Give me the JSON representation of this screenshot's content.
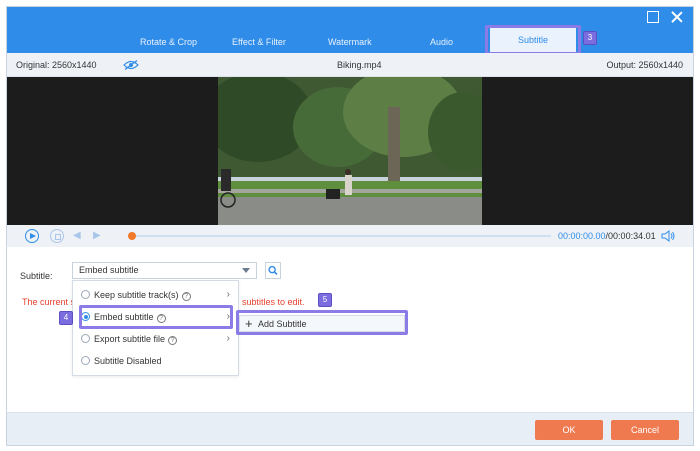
{
  "tabs": [
    {
      "label": "Rotate & Crop"
    },
    {
      "label": "Effect & Filter"
    },
    {
      "label": "Watermark"
    },
    {
      "label": "Audio"
    },
    {
      "label": "Subtitle",
      "active": true
    }
  ],
  "steps": {
    "tab": "3",
    "embed": "4",
    "add": "5"
  },
  "infobar": {
    "original": "Original: 2560x1440",
    "filename": "Biking.mp4",
    "output": "Output: 2560x1440"
  },
  "player": {
    "current_time": "00:00:00.00",
    "total_time": "/00:00:34.01",
    "progress": 0.0
  },
  "subtitle": {
    "label": "Subtitle:",
    "selected": "Embed subtitle",
    "warning_start": "The current s",
    "warning_end": "subtitles to edit.",
    "options": [
      {
        "label": "Keep subtitle track(s)",
        "help": "?",
        "submenu": true,
        "selected": false
      },
      {
        "label": "Embed subtitle",
        "help": "?",
        "submenu": true,
        "selected": true
      },
      {
        "label": "Export subtitle file",
        "help": "?",
        "submenu": true,
        "selected": false
      },
      {
        "label": "Subtitle Disabled",
        "help": "",
        "submenu": false,
        "selected": false
      }
    ],
    "submenu_item": "Add Subtitle"
  },
  "footer": {
    "ok": "OK",
    "cancel": "Cancel"
  },
  "colors": {
    "accent": "#2f8ce8",
    "highlight": "#8b7be6",
    "button": "#f07a50",
    "warning": "#e8412f"
  }
}
